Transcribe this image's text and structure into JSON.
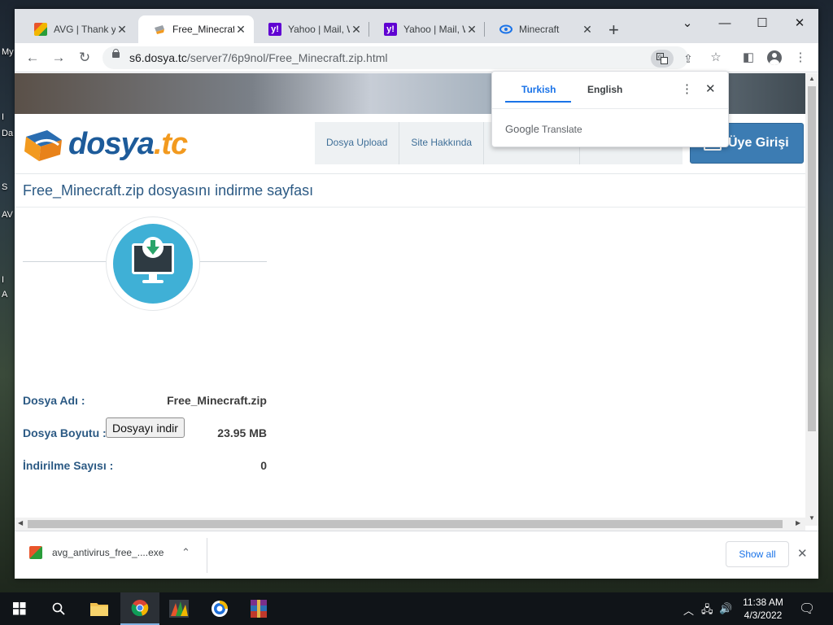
{
  "desktop": {
    "labels": [
      "My",
      "I",
      "Da",
      "S",
      "AV",
      "I",
      "A"
    ]
  },
  "tabs": [
    {
      "title": "AVG | Thank yo",
      "icon": "avg-icon"
    },
    {
      "title": "Free_Minecraft",
      "icon": "dosya-icon"
    },
    {
      "title": "Yahoo | Mail, W",
      "icon": "yahoo-icon"
    },
    {
      "title": "Yahoo | Mail, W",
      "icon": "yahoo-icon"
    },
    {
      "title": "Minecraft",
      "icon": "minecraft-icon"
    }
  ],
  "address": {
    "host": "s6.dosya.tc",
    "path": "/server7/6p9nol/Free_Minecraft.zip.html"
  },
  "site": {
    "logo_main": "dosya",
    "logo_tld": ".tc",
    "nav": [
      "Dosya Upload",
      "Site Hakkında"
    ],
    "login_label": "Üye Girişi",
    "page_title": "Free_Minecraft.zip dosyasını indirme sayfası"
  },
  "file": {
    "name_label": "Dosya Adı :",
    "name_value": "Free_Minecraft.zip",
    "size_label": "Dosya Boyutu :",
    "size_value": "23.95 MB",
    "count_label": "İndirilme Sayısı :",
    "count_value": "0",
    "download_button": "Dosyayı indir"
  },
  "translate": {
    "source": "Turkish",
    "target": "English",
    "brand_google": "Google",
    "brand_translate": "Translate"
  },
  "downloads": {
    "file": "avg_antivirus_free_....exe",
    "show_all": "Show all"
  },
  "clock": {
    "time": "11:38 AM",
    "date": "4/3/2022"
  },
  "colors": {
    "accent": "#1a73e8",
    "site_blue": "#2c5a84",
    "login_blue": "#3c7cb3",
    "download_teal": "#3fb0d6"
  }
}
